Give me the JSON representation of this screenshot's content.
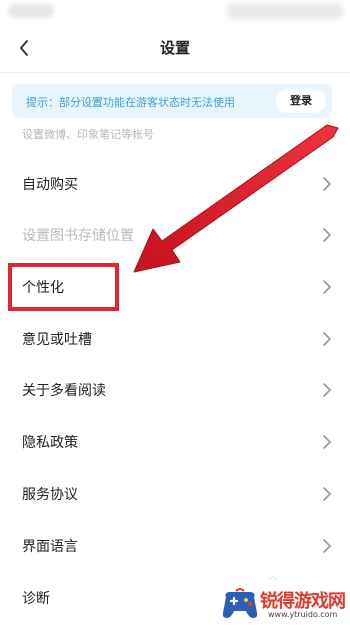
{
  "header": {
    "title": "设置",
    "back_icon": "chevron-left-icon"
  },
  "notice": {
    "text": "提示：部分设置功能在游客状态时无法使用",
    "login_label": "登录"
  },
  "account_hint": "设置微博、印象笔记等帐号",
  "menu": {
    "items": [
      {
        "label": "自动购买",
        "enabled": true
      },
      {
        "label": "设置图书存储位置",
        "enabled": false
      },
      {
        "label": "个性化",
        "enabled": true,
        "highlighted": true
      },
      {
        "label": "意见或吐槽",
        "enabled": true
      },
      {
        "label": "关于多看阅读",
        "enabled": true
      },
      {
        "label": "隐私政策",
        "enabled": true
      },
      {
        "label": "服务协议",
        "enabled": true
      },
      {
        "label": "界面语言",
        "enabled": true
      },
      {
        "label": "诊断",
        "enabled": true
      }
    ]
  },
  "annotation": {
    "color": "#e3232f",
    "arrow_icon": "red-arrow-icon"
  },
  "watermark": {
    "title": "锐得游戏网",
    "url": "www.ytruido.com"
  },
  "colors": {
    "notice_bg": "#e9f5fd",
    "notice_text": "#3d9fd6",
    "disabled_text": "#bbbbbb",
    "watermark_red": "#e33a2d"
  }
}
